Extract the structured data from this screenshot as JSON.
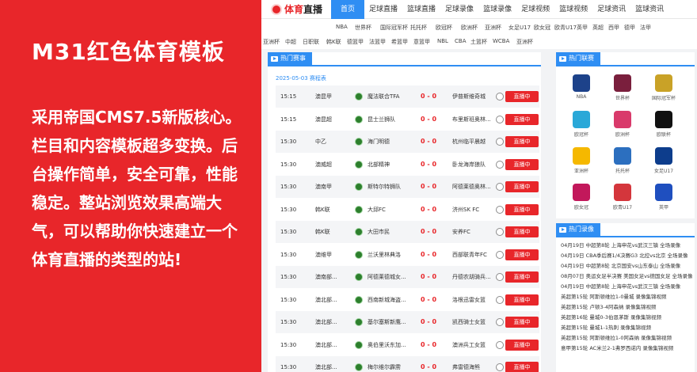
{
  "promo": {
    "title": "M31红色体育模板",
    "description": "采用帝国CMS7.5新版核心。栏目和内容模板超多变换。后台操作简单，安全可靠，性能稳定。整站浏览效果高端大气，可以帮助你快速建立一个体育直播的类型的站!"
  },
  "site": {
    "logo_prefix": "体育",
    "logo_suffix": "直播",
    "nav": [
      "首页",
      "足球直播",
      "篮球直播",
      "足球录像",
      "篮球录像",
      "足球视频",
      "篮球视频",
      "足球资讯",
      "篮球资讯"
    ],
    "tags_row1": [
      "NBA",
      "世界杯",
      "国际冠军杯",
      "托托杯",
      "欧冠杯",
      "欧洲杯",
      "亚洲杯",
      "女足U17",
      "欧女冠",
      "欧青U17",
      "英甲",
      "英超",
      "西甲",
      "德甲",
      "法甲"
    ],
    "tags_row2": [
      "亚洲杯",
      "中超",
      "日职联",
      "韩K联",
      "德篮甲",
      "法篮甲",
      "希篮甲",
      "意篮甲",
      "NBL",
      "CBA",
      "土篮杯",
      "WCBA",
      "亚洲杯"
    ],
    "hot_matches_label": "热门赛事",
    "schedule_date": "2025-05-03 赛程表",
    "live_label": "直播中",
    "matches": [
      {
        "time": "15:15",
        "league": "澳昆甲",
        "home": "魔法联合TFA",
        "score": "0 - 0",
        "away": "伊普斯维奇城"
      },
      {
        "time": "15:15",
        "league": "澳昆超",
        "home": "昆士兰狮队",
        "score": "0 - 0",
        "away": "布里斯班奥林..."
      },
      {
        "time": "15:30",
        "league": "中乙",
        "home": "海门明德",
        "score": "0 - 0",
        "away": "杭州临平晨越"
      },
      {
        "time": "15:30",
        "league": "澳威超",
        "home": "北部精神",
        "score": "0 - 0",
        "away": "卧龙海岸狼队"
      },
      {
        "time": "15:30",
        "league": "澳南甲",
        "home": "斯特尔特狮队",
        "score": "0 - 0",
        "away": "阿德莱德奥林..."
      },
      {
        "time": "15:30",
        "league": "韩K联",
        "home": "大邱FC",
        "score": "0 - 0",
        "away": "济州SK FC"
      },
      {
        "time": "15:30",
        "league": "韩K联",
        "home": "大田市民",
        "score": "0 - 0",
        "away": "安养FC"
      },
      {
        "time": "15:30",
        "league": "澳维甲",
        "home": "兰沃里林典洛",
        "score": "0 - 0",
        "away": "西部联青年FC"
      },
      {
        "time": "15:30",
        "league": "澳南部...",
        "home": "阿德莱德城女...",
        "score": "0 - 0",
        "away": "丹德农胡骑兵..."
      },
      {
        "time": "15:30",
        "league": "澳北部...",
        "home": "西南新城海盗...",
        "score": "0 - 0",
        "away": "洛根迅雷女篮"
      },
      {
        "time": "15:30",
        "league": "澳北部...",
        "home": "基尔塞斯新鹰...",
        "score": "0 - 0",
        "away": "凯西骑士女篮"
      },
      {
        "time": "15:30",
        "league": "澳北部...",
        "home": "奥伯里沃东加...",
        "score": "0 - 0",
        "away": "澳洲兵工女篮"
      },
      {
        "time": "15:30",
        "league": "澳北部...",
        "home": "梅尔维尔霹雳",
        "score": "0 - 0",
        "away": "弗雷德海熊"
      }
    ],
    "hot_leagues_label": "热门联赛",
    "leagues": [
      {
        "name": "NBA",
        "color": "#1d428a"
      },
      {
        "name": "世界杯",
        "color": "#7a1f3d"
      },
      {
        "name": "国际冠军杯",
        "color": "#c9a227"
      },
      {
        "name": "欧冠杯",
        "color": "#2aa8d8"
      },
      {
        "name": "欧洲杯",
        "color": "#d93a6b"
      },
      {
        "name": "欧联杯",
        "color": "#111111"
      },
      {
        "name": "亚洲杯",
        "color": "#f5b800"
      },
      {
        "name": "托托杯",
        "color": "#2c6fbf"
      },
      {
        "name": "女足U17",
        "color": "#0d3d8c"
      },
      {
        "name": "欧女冠",
        "color": "#c2185b"
      },
      {
        "name": "欧青U17",
        "color": "#d4363c"
      },
      {
        "name": "英甲",
        "color": "#1f4fbf"
      }
    ],
    "hot_videos_label": "热门录像",
    "videos": [
      "04月19日 中超第8轮 上海申花vs武汉三镇 全场录像",
      "04月19日 CBA季后赛1/4决赛G3 北控vs北京 全场录像",
      "04月19日 中超第8轮 北京国安vs山东泰山 全场录像",
      "08月07日 奥运女足半决赛 美国女足vs德国女足 全场录像",
      "04月19日 中超第8轮 上海申花vs武汉三镇 全场录像",
      "英超第15轮 阿斯顿维拉1-0曼城 录像集锦视频",
      "英超第15轮 卢顿3-4阿森纳 录像集锦视频",
      "英超第16轮 曼城0-3伯恩茅斯 录像集锦视频",
      "英超第15轮 曼城1-1热刺 录像集锦视频",
      "英超第15轮 阿斯顿维拉1-0阿森纳 录像集锦视频",
      "意甲第15轮 AC米兰2-1弗罗西诺内 录像集锦视频"
    ]
  }
}
